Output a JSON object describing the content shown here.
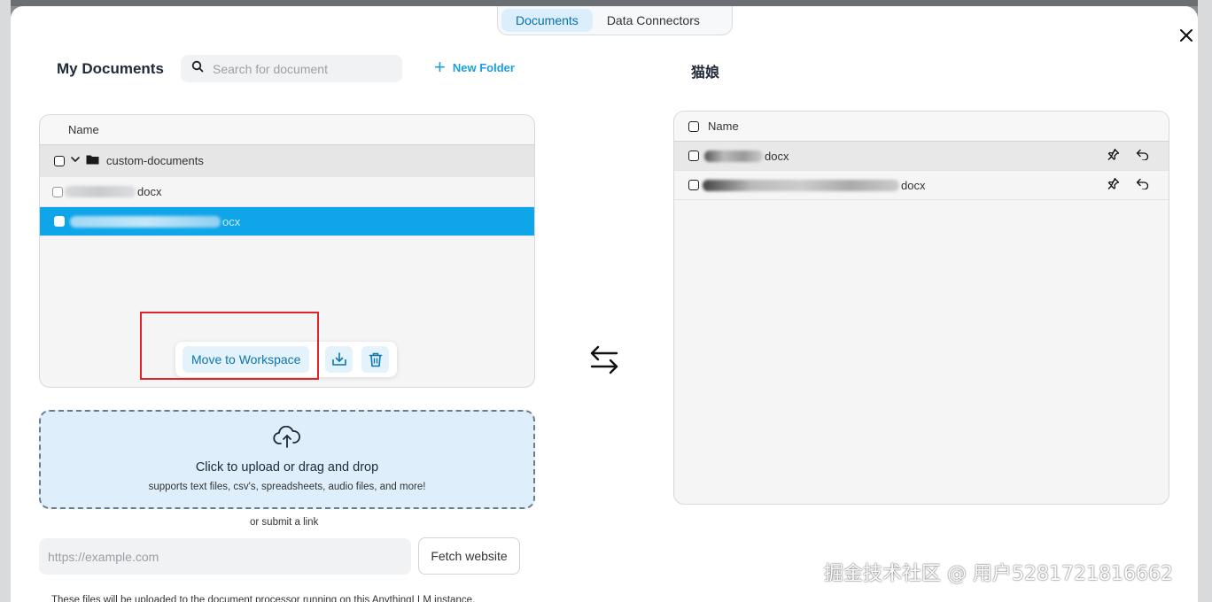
{
  "tabs": [
    {
      "label": "Documents",
      "active": true
    },
    {
      "label": "Data Connectors",
      "active": false
    }
  ],
  "left": {
    "title": "My Documents",
    "search_placeholder": "Search for document",
    "new_folder_label": "New Folder",
    "column_name": "Name",
    "folder_name": "custom-documents",
    "files": [
      {
        "suffix": "docx",
        "selected": false
      },
      {
        "suffix": "ocx",
        "selected": true
      }
    ],
    "actions": {
      "move_label": "Move to Workspace",
      "embed_icon": "embed-tray-icon",
      "delete_icon": "trash-icon"
    }
  },
  "upload": {
    "title": "Click to upload or drag and drop",
    "subtitle": "supports text files, csv's, spreadsheets, audio files, and more!",
    "or_link": "or submit a link",
    "url_placeholder": "https://example.com",
    "fetch_label": "Fetch website",
    "footer_note": "These files will be uploaded to the document processor running on this AnythingLLM instance."
  },
  "right": {
    "title": "猫娘",
    "column_name": "Name",
    "files": [
      {
        "suffix": "docx"
      },
      {
        "suffix": "docx"
      }
    ]
  },
  "watermark": "掘金技术社区 @ 用户5281721816662",
  "colors": {
    "accent": "#0ea5e9",
    "accent_text": "#0c76ad",
    "highlight": "#e0242a",
    "dropzone_bg": "#deeefb"
  }
}
